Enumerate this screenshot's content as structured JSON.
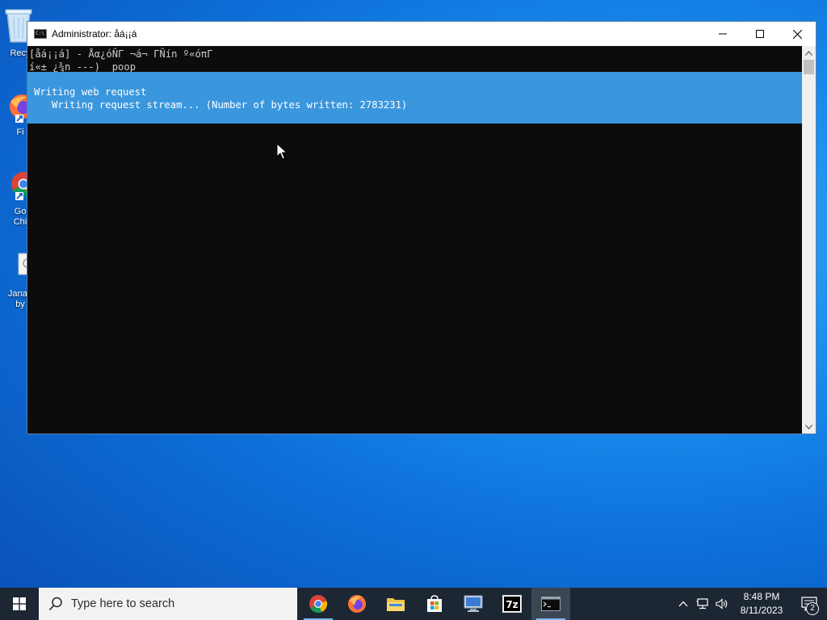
{
  "desktop": {
    "icons": [
      {
        "label_line1": "Recy",
        "label_line2": ""
      },
      {
        "label_line1": "Fi",
        "label_line2": ""
      },
      {
        "label_line1": "Go",
        "label_line2": "Chi"
      },
      {
        "label_line1": "Jana+",
        "label_line2": "by"
      }
    ]
  },
  "window": {
    "title": "Administrator:  åá¡¡á",
    "minimize_icon": "minimize-icon",
    "maximize_icon": "maximize-icon",
    "close_icon": "close-icon"
  },
  "console": {
    "line1": "[åá¡¡á] - Åα¿óÑΓ ¬á¬ ΓÑín º«óπΓ",
    "line2": "í«± ¿¾n ---)  poop",
    "progress": {
      "activity": "Writing web request",
      "status": "   Writing request stream... (Number of bytes written: 2783231)"
    },
    "band_color": "#3a96dd"
  },
  "taskbar": {
    "search_placeholder": "Type here to search",
    "apps": [
      "chrome-icon",
      "firefox-icon",
      "file-explorer-icon",
      "store-icon",
      "remote-desktop-icon",
      "7zip-icon",
      "cmd-icon"
    ],
    "sevenzip_label": "7z",
    "clock_time": "8:48 PM",
    "clock_date": "8/11/2023",
    "notification_count": "2"
  },
  "colors": {
    "taskbar": "#1c2733",
    "console_bg": "#0c0c0c",
    "accent": "#3a96dd"
  }
}
